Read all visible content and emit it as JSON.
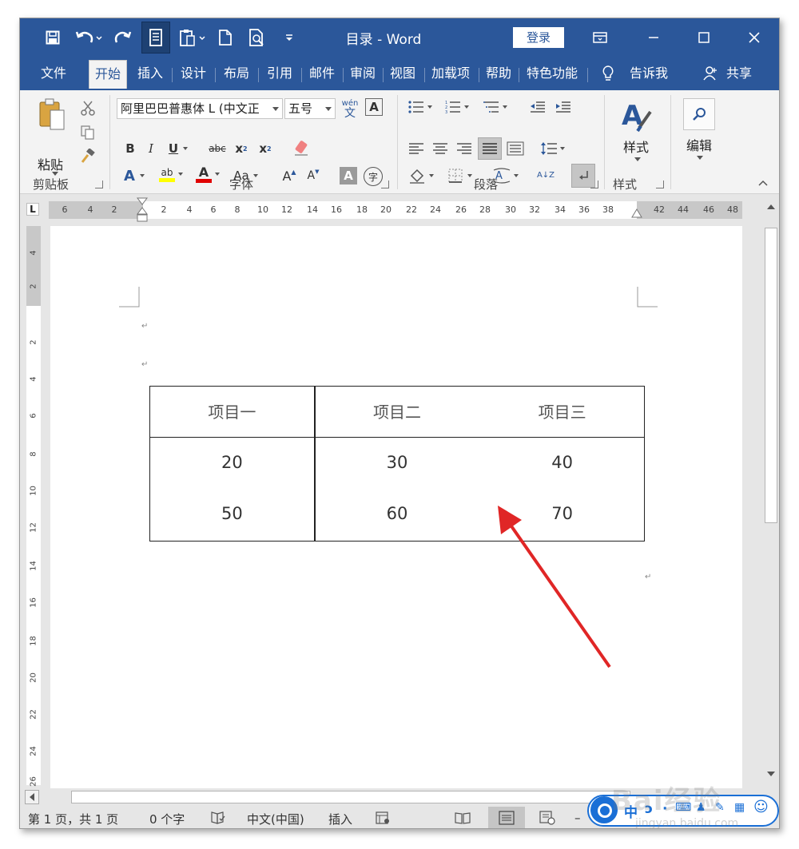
{
  "titlebar": {
    "title": "目录  -  Word",
    "login": "登录"
  },
  "tabs": [
    {
      "label": "文件"
    },
    {
      "label": "开始"
    },
    {
      "label": "插入"
    },
    {
      "label": "设计"
    },
    {
      "label": "布局"
    },
    {
      "label": "引用"
    },
    {
      "label": "邮件"
    },
    {
      "label": "审阅"
    },
    {
      "label": "视图"
    },
    {
      "label": "加载项"
    },
    {
      "label": "帮助"
    },
    {
      "label": "特色功能"
    },
    {
      "label": "告诉我"
    },
    {
      "label": "共享"
    }
  ],
  "ribbon": {
    "paste_label": "粘贴",
    "clipboard_label": "剪贴板",
    "font_label": "字体",
    "paragraph_label": "段落",
    "styles_label": "样式",
    "styles_button": "样式",
    "editing_button": "编辑",
    "font_name": "阿里巴巴普惠体 L (中文正",
    "font_size": "五号",
    "phonetic_top": "wén",
    "phonetic_bottom": "文",
    "bold": "B",
    "italic": "I",
    "underline": "U",
    "strike": "abc",
    "sub": "x",
    "sup": "x",
    "font_color_letter": "A",
    "case": "Aa",
    "grow": "A",
    "shrink": "A",
    "char_shade": "A",
    "enclose": "字",
    "sort": "A↓Z"
  },
  "ruler": {
    "corner": "L",
    "ticks": [
      "6",
      "4",
      "2",
      "2",
      "4",
      "6",
      "8",
      "10",
      "12",
      "14",
      "16",
      "18",
      "20",
      "22",
      "24",
      "26",
      "28",
      "30",
      "32",
      "34",
      "36",
      "38",
      "42",
      "44",
      "46",
      "48"
    ]
  },
  "vruler": {
    "ticks": [
      "4",
      "2",
      "2",
      "4",
      "6",
      "8",
      "10",
      "12",
      "14",
      "16",
      "18",
      "20",
      "22",
      "24",
      "26"
    ]
  },
  "table": {
    "header": [
      "项目一",
      "项目二",
      "项目三"
    ],
    "rows": [
      [
        "20",
        "30",
        "40"
      ],
      [
        "50",
        "60",
        "70"
      ]
    ]
  },
  "status": {
    "page": "第 1 页，共 1 页",
    "words": "0 个字",
    "language": "中文(中国)",
    "mode": "插入",
    "zoom_minus": "–"
  },
  "ime": {
    "lang": "中",
    "punct": "ɔ",
    "dot": "·",
    "watermark": "Bai经验",
    "watermark_sub": "jingyan.baidu.com"
  },
  "colors": {
    "brand": "#2b579a",
    "arrow": "#e02626",
    "highlight_yellow": "#ffff00",
    "font_red": "#e00000"
  }
}
